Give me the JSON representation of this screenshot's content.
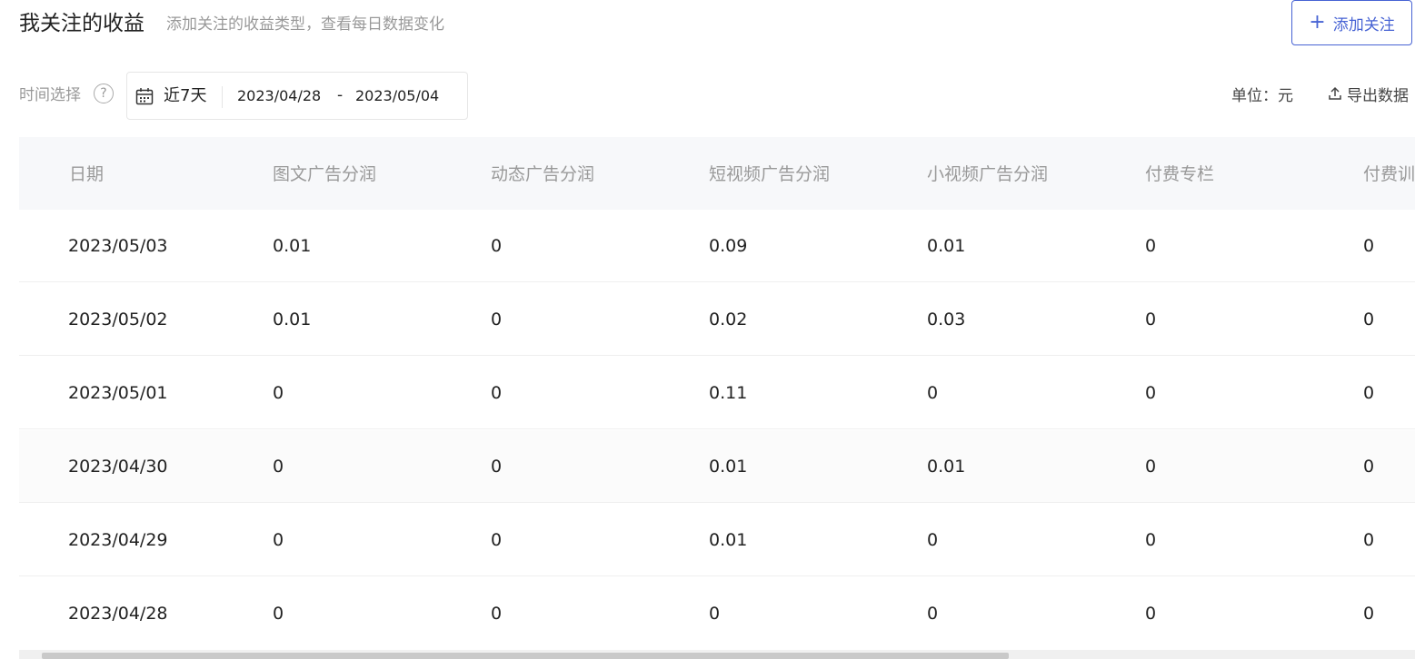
{
  "header": {
    "title": "我关注的收益",
    "subtitle": "添加关注的收益类型，查看每日数据变化",
    "add_button": "添加关注",
    "add_icon": "+"
  },
  "filter": {
    "time_label": "时间选择",
    "help_icon": "?",
    "preset": "近7天",
    "start_date": "2023/04/28",
    "separator": "-",
    "end_date": "2023/05/04",
    "unit": "单位：元",
    "export": "导出数据"
  },
  "table": {
    "columns": [
      "日期",
      "图文广告分润",
      "动态广告分润",
      "短视频广告分润",
      "小视频广告分润",
      "付费专栏",
      "付费训"
    ],
    "rows": [
      [
        "2023/05/03",
        "0.01",
        "0",
        "0.09",
        "0.01",
        "0",
        "0"
      ],
      [
        "2023/05/02",
        "0.01",
        "0",
        "0.02",
        "0.03",
        "0",
        "0"
      ],
      [
        "2023/05/01",
        "0",
        "0",
        "0.11",
        "0",
        "0",
        "0"
      ],
      [
        "2023/04/30",
        "0",
        "0",
        "0.01",
        "0.01",
        "0",
        "0"
      ],
      [
        "2023/04/29",
        "0",
        "0",
        "0.01",
        "0",
        "0",
        "0"
      ],
      [
        "2023/04/28",
        "0",
        "0",
        "0",
        "0",
        "0",
        "0"
      ]
    ]
  },
  "colors": {
    "accent": "#4763d4",
    "muted_text": "#999999",
    "header_bg": "#f7f8fa"
  }
}
